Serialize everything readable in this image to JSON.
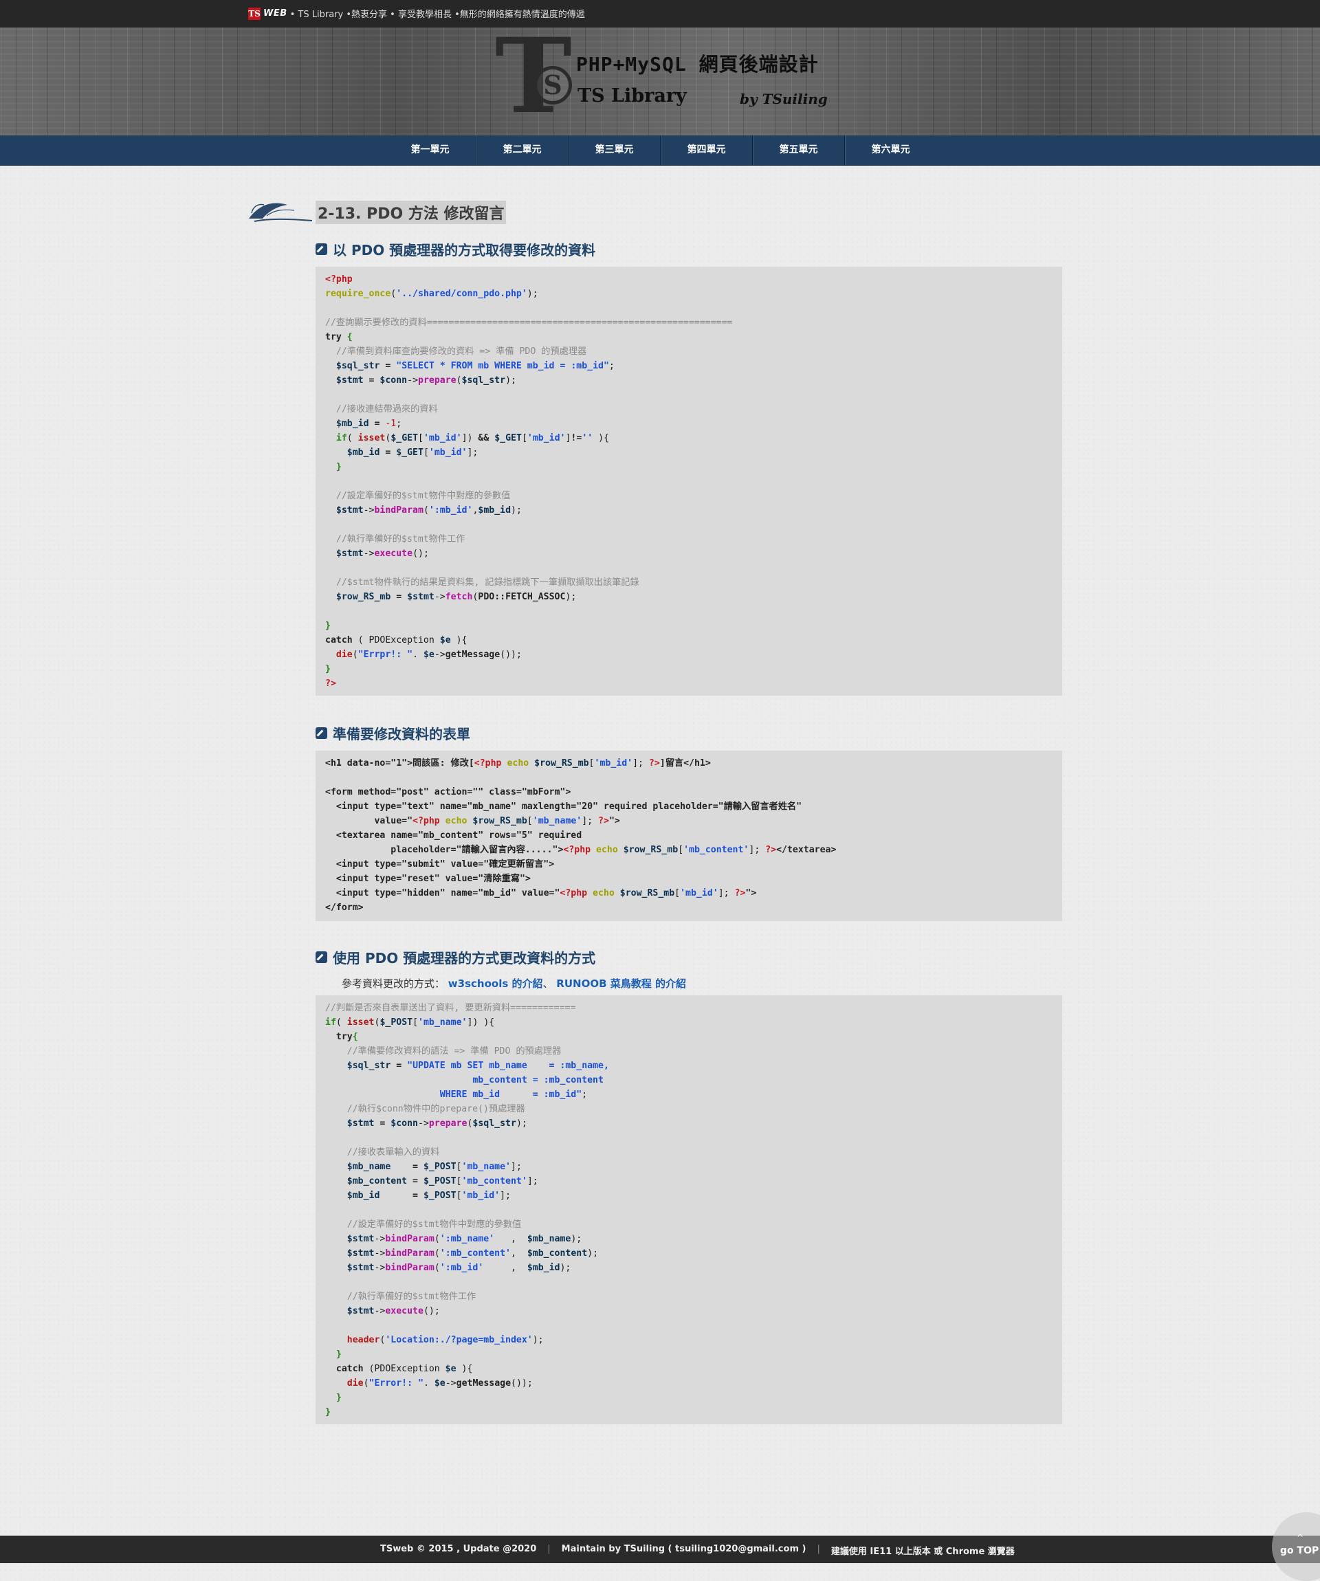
{
  "topbar": {
    "logo": "TS",
    "web": "WEB",
    "tagline": "• TS Library •熱衷分享 • 享受教學相長 •無形的網絡擁有熱情溫度的傳遞"
  },
  "header": {
    "title": "PHP+MySQL 網頁後端設計",
    "subtitle": "TS Library",
    "by": "by TSuiling",
    "mark_t": "T",
    "mark_s": "S"
  },
  "nav": {
    "items": [
      {
        "label": "第一單元"
      },
      {
        "label": "第二單元"
      },
      {
        "label": "第三單元"
      },
      {
        "label": "第四單元"
      },
      {
        "label": "第五單元"
      },
      {
        "label": "第六單元"
      }
    ]
  },
  "page": {
    "title": "2-13. PDO 方法 修改留言"
  },
  "sections": [
    {
      "heading": "以 PDO 預處理器的方式取得要修改的資料",
      "code": [
        [
          [
            "t-tag",
            "<?php"
          ]
        ],
        [
          [
            "t-fn",
            "require_once"
          ],
          [
            "",
            "("
          ],
          [
            "t-str",
            "'../shared/conn_pdo.php'"
          ],
          [
            "",
            ");"
          ]
        ],
        [],
        [
          [
            "t-cmt",
            "//查詢顯示要修改的資料========================================================"
          ]
        ],
        [
          [
            "t-kw",
            "try "
          ],
          [
            "t-brk",
            "{"
          ]
        ],
        [
          [
            "t-cmt",
            "  //準備到資料庫查詢要修改的資料 => 準備 PDO 的預處理器"
          ]
        ],
        [
          [
            "",
            "  "
          ],
          [
            "t-var",
            "$sql_str"
          ],
          [
            "t-kw",
            " = "
          ],
          [
            "t-str",
            "\"SELECT * FROM mb WHERE mb_id = :mb_id\""
          ],
          [
            "",
            ";"
          ]
        ],
        [
          [
            "",
            "  "
          ],
          [
            "t-var",
            "$stmt"
          ],
          [
            "t-kw",
            " = "
          ],
          [
            "t-var",
            "$conn"
          ],
          [
            "",
            "->"
          ],
          [
            "t-mtd",
            "prepare"
          ],
          [
            "",
            "("
          ],
          [
            "t-var",
            "$sql_str"
          ],
          [
            "",
            ");"
          ]
        ],
        [],
        [
          [
            "t-cmt",
            "  //接收連結帶過來的資料"
          ]
        ],
        [
          [
            "",
            "  "
          ],
          [
            "t-var",
            "$mb_id"
          ],
          [
            "t-kw",
            " = "
          ],
          [
            "t-num",
            "-1"
          ],
          [
            "",
            ";"
          ]
        ],
        [
          [
            "",
            "  "
          ],
          [
            "t-brk",
            "if"
          ],
          [
            "",
            "( "
          ],
          [
            "t-die",
            "isset"
          ],
          [
            "",
            "("
          ],
          [
            "t-var",
            "$_GET"
          ],
          [
            "",
            "["
          ],
          [
            "t-str",
            "'mb_id'"
          ],
          [
            "",
            "]) "
          ],
          [
            "t-kw",
            "&&"
          ],
          [
            "",
            " "
          ],
          [
            "t-var",
            "$_GET"
          ],
          [
            "",
            "["
          ],
          [
            "t-str",
            "'mb_id'"
          ],
          [
            "",
            "]"
          ],
          [
            "t-kw",
            "!="
          ],
          [
            "t-str",
            "''"
          ],
          [
            "",
            " ){"
          ]
        ],
        [
          [
            "",
            "    "
          ],
          [
            "t-var",
            "$mb_id"
          ],
          [
            "t-kw",
            " = "
          ],
          [
            "t-var",
            "$_GET"
          ],
          [
            "",
            "["
          ],
          [
            "t-str",
            "'mb_id'"
          ],
          [
            "",
            "];"
          ]
        ],
        [
          [
            "",
            "  "
          ],
          [
            "t-brk",
            "}"
          ]
        ],
        [],
        [
          [
            "t-cmt",
            "  //設定準備好的$stmt物件中對應的參數值"
          ]
        ],
        [
          [
            "",
            "  "
          ],
          [
            "t-var",
            "$stmt"
          ],
          [
            "",
            "->"
          ],
          [
            "t-mtd",
            "bindParam"
          ],
          [
            "",
            "("
          ],
          [
            "t-str",
            "':mb_id'"
          ],
          [
            "",
            ","
          ],
          [
            "t-var",
            "$mb_id"
          ],
          [
            "",
            ");"
          ]
        ],
        [],
        [
          [
            "t-cmt",
            "  //執行準備好的$stmt物件工作"
          ]
        ],
        [
          [
            "",
            "  "
          ],
          [
            "t-var",
            "$stmt"
          ],
          [
            "",
            "->"
          ],
          [
            "t-mtd",
            "execute"
          ],
          [
            "",
            "();"
          ]
        ],
        [],
        [
          [
            "t-cmt",
            "  //$stmt物件執行的結果是資料集, 記錄指標跳下一筆擷取擷取出該筆記錄"
          ]
        ],
        [
          [
            "",
            "  "
          ],
          [
            "t-var",
            "$row_RS_mb"
          ],
          [
            "t-kw",
            " = "
          ],
          [
            "t-var",
            "$stmt"
          ],
          [
            "",
            "->"
          ],
          [
            "t-mtd",
            "fetch"
          ],
          [
            "",
            "("
          ],
          [
            "t-kw",
            "PDO::FETCH_ASSOC"
          ],
          [
            "",
            ");"
          ]
        ],
        [],
        [
          [
            "t-brk",
            "}"
          ]
        ],
        [
          [
            "t-kw",
            "catch"
          ],
          [
            "",
            " ( PDOException "
          ],
          [
            "t-var",
            "$e"
          ],
          [
            "",
            " ){"
          ]
        ],
        [
          [
            "",
            "  "
          ],
          [
            "t-die",
            "die"
          ],
          [
            "",
            "("
          ],
          [
            "t-str",
            "\"Errpr!: \""
          ],
          [
            "",
            ". "
          ],
          [
            "t-var",
            "$e"
          ],
          [
            "",
            "->"
          ],
          [
            "t-kw",
            "getMessage"
          ],
          [
            "",
            "());"
          ]
        ],
        [
          [
            "t-brk",
            "}"
          ]
        ],
        [
          [
            "t-tag",
            "?>"
          ]
        ]
      ]
    },
    {
      "heading": "準備要修改資料的表單",
      "code": [
        [
          [
            "t-kw",
            "<h1 data-no=\"1\">問該區: 修改["
          ],
          [
            "t-tag",
            "<?php "
          ],
          [
            "t-fn",
            "echo "
          ],
          [
            "t-var",
            "$row_RS_mb"
          ],
          [
            "",
            "["
          ],
          [
            "t-str",
            "'mb_id'"
          ],
          [
            "",
            "]; "
          ],
          [
            "t-tag",
            "?>"
          ],
          [
            "t-kw",
            "]留言</h1>"
          ]
        ],
        [],
        [
          [
            "t-kw",
            "<form method=\"post\" action=\"\" class=\"mbForm\">"
          ]
        ],
        [
          [
            "t-kw",
            "  <input type=\"text\" name=\"mb_name\" maxlength=\"20\" required placeholder=\"請輸入留言者姓名\""
          ]
        ],
        [
          [
            "t-kw",
            "         value=\""
          ],
          [
            "t-tag",
            "<?php "
          ],
          [
            "t-fn",
            "echo "
          ],
          [
            "t-var",
            "$row_RS_mb"
          ],
          [
            "",
            "["
          ],
          [
            "t-str",
            "'mb_name'"
          ],
          [
            "",
            "]; "
          ],
          [
            "t-tag",
            "?>"
          ],
          [
            "t-kw",
            "\">"
          ]
        ],
        [
          [
            "t-kw",
            "  <textarea name=\"mb_content\" rows=\"5\" required"
          ]
        ],
        [
          [
            "t-kw",
            "            placeholder=\"請輸入留言內容.....\">"
          ],
          [
            "t-tag",
            "<?php "
          ],
          [
            "t-fn",
            "echo "
          ],
          [
            "t-var",
            "$row_RS_mb"
          ],
          [
            "",
            "["
          ],
          [
            "t-str",
            "'mb_content'"
          ],
          [
            "",
            "]; "
          ],
          [
            "t-tag",
            "?>"
          ],
          [
            "t-kw",
            "</textarea>"
          ]
        ],
        [
          [
            "t-kw",
            "  <input type=\"submit\" value=\"確定更新留言\">"
          ]
        ],
        [
          [
            "t-kw",
            "  <input type=\"reset\" value=\"清除重寫\">"
          ]
        ],
        [
          [
            "t-kw",
            "  <input type=\"hidden\" name=\"mb_id\" value=\""
          ],
          [
            "t-tag",
            "<?php "
          ],
          [
            "t-fn",
            "echo "
          ],
          [
            "t-var",
            "$row_RS_mb"
          ],
          [
            "",
            "["
          ],
          [
            "t-str",
            "'mb_id'"
          ],
          [
            "",
            "]; "
          ],
          [
            "t-tag",
            "?>"
          ],
          [
            "t-kw",
            "\">"
          ]
        ],
        [
          [
            "t-kw",
            "</form>"
          ]
        ]
      ]
    },
    {
      "heading": "使用 PDO 預處理器的方式更改資料的方式",
      "ref_label": "參考資料更改的方式：",
      "ref_link1": "w3schools 的介紹",
      "ref_sep": "、",
      "ref_link2": "RUNOOB 菜鳥教程 的介紹",
      "code": [
        [
          [
            "t-cmt",
            "//判斷是否來自表單送出了資料, 要更新資料============"
          ]
        ],
        [
          [
            "t-brk",
            "if"
          ],
          [
            "",
            "( "
          ],
          [
            "t-die",
            "isset"
          ],
          [
            "",
            "("
          ],
          [
            "t-var",
            "$_POST"
          ],
          [
            "",
            "["
          ],
          [
            "t-str",
            "'mb_name'"
          ],
          [
            "",
            "]) ){"
          ]
        ],
        [
          [
            "t-kw",
            "  try"
          ],
          [
            "t-brk",
            "{"
          ]
        ],
        [
          [
            "t-cmt",
            "    //準備要修改資料的語法 => 準備 PDO 的預處理器"
          ]
        ],
        [
          [
            "",
            "    "
          ],
          [
            "t-var",
            "$sql_str"
          ],
          [
            "t-kw",
            " = "
          ],
          [
            "t-str",
            "\"UPDATE mb SET mb_name    = :mb_name,"
          ]
        ],
        [
          [
            "t-str",
            "                           mb_content = :mb_content"
          ]
        ],
        [
          [
            "t-str",
            "                     WHERE mb_id      = :mb_id\""
          ],
          [
            "",
            ";"
          ]
        ],
        [
          [
            "t-cmt",
            "    //執行$conn物件中的prepare()預處理器"
          ]
        ],
        [
          [
            "",
            "    "
          ],
          [
            "t-var",
            "$stmt"
          ],
          [
            "t-kw",
            " = "
          ],
          [
            "t-var",
            "$conn"
          ],
          [
            "",
            "->"
          ],
          [
            "t-mtd",
            "prepare"
          ],
          [
            "",
            "("
          ],
          [
            "t-var",
            "$sql_str"
          ],
          [
            "",
            ");"
          ]
        ],
        [],
        [
          [
            "t-cmt",
            "    //接收表單輸入的資料"
          ]
        ],
        [
          [
            "",
            "    "
          ],
          [
            "t-var",
            "$mb_name   "
          ],
          [
            "t-kw",
            " = "
          ],
          [
            "t-var",
            "$_POST"
          ],
          [
            "",
            "["
          ],
          [
            "t-str",
            "'mb_name'"
          ],
          [
            "",
            "];"
          ]
        ],
        [
          [
            "",
            "    "
          ],
          [
            "t-var",
            "$mb_content"
          ],
          [
            "t-kw",
            " = "
          ],
          [
            "t-var",
            "$_POST"
          ],
          [
            "",
            "["
          ],
          [
            "t-str",
            "'mb_content'"
          ],
          [
            "",
            "];"
          ]
        ],
        [
          [
            "",
            "    "
          ],
          [
            "t-var",
            "$mb_id     "
          ],
          [
            "t-kw",
            " = "
          ],
          [
            "t-var",
            "$_POST"
          ],
          [
            "",
            "["
          ],
          [
            "t-str",
            "'mb_id'"
          ],
          [
            "",
            "];"
          ]
        ],
        [],
        [
          [
            "t-cmt",
            "    //設定準備好的$stmt物件中對應的參數值"
          ]
        ],
        [
          [
            "",
            "    "
          ],
          [
            "t-var",
            "$stmt"
          ],
          [
            "",
            "->"
          ],
          [
            "t-mtd",
            "bindParam"
          ],
          [
            "",
            "("
          ],
          [
            "t-str",
            "':mb_name'   "
          ],
          [
            "",
            ",  "
          ],
          [
            "t-var",
            "$mb_name"
          ],
          [
            "",
            ");"
          ]
        ],
        [
          [
            "",
            "    "
          ],
          [
            "t-var",
            "$stmt"
          ],
          [
            "",
            "->"
          ],
          [
            "t-mtd",
            "bindParam"
          ],
          [
            "",
            "("
          ],
          [
            "t-str",
            "':mb_content'"
          ],
          [
            "",
            ",  "
          ],
          [
            "t-var",
            "$mb_content"
          ],
          [
            "",
            ");"
          ]
        ],
        [
          [
            "",
            "    "
          ],
          [
            "t-var",
            "$stmt"
          ],
          [
            "",
            "->"
          ],
          [
            "t-mtd",
            "bindParam"
          ],
          [
            "",
            "("
          ],
          [
            "t-str",
            "':mb_id'     "
          ],
          [
            "",
            ",  "
          ],
          [
            "t-var",
            "$mb_id"
          ],
          [
            "",
            ");"
          ]
        ],
        [],
        [
          [
            "t-cmt",
            "    //執行準備好的$stmt物件工作"
          ]
        ],
        [
          [
            "",
            "    "
          ],
          [
            "t-var",
            "$stmt"
          ],
          [
            "",
            "->"
          ],
          [
            "t-mtd",
            "execute"
          ],
          [
            "",
            "();"
          ]
        ],
        [],
        [
          [
            "",
            "    "
          ],
          [
            "t-die",
            "header"
          ],
          [
            "",
            "("
          ],
          [
            "t-str",
            "'Location:./?page=mb_index'"
          ],
          [
            "",
            ");"
          ]
        ],
        [
          [
            "t-brk",
            "  }"
          ]
        ],
        [
          [
            "t-kw",
            "  catch"
          ],
          [
            "",
            " (PDOException "
          ],
          [
            "t-var",
            "$e"
          ],
          [
            "",
            " ){"
          ]
        ],
        [
          [
            "",
            "    "
          ],
          [
            "t-die",
            "die"
          ],
          [
            "",
            "("
          ],
          [
            "t-str",
            "\"Error!: \""
          ],
          [
            "",
            ". "
          ],
          [
            "t-var",
            "$e"
          ],
          [
            "",
            "->"
          ],
          [
            "t-kw",
            "getMessage"
          ],
          [
            "",
            "());"
          ]
        ],
        [
          [
            "t-brk",
            "  }"
          ]
        ],
        [
          [
            "t-brk",
            "}"
          ]
        ]
      ]
    }
  ],
  "footer": {
    "copyright": "TSweb © 2015 , Update @2020",
    "maintain": "Maintain by TSuiling ( tsuiling1020@gmail.com )",
    "browser": "建議使用 IE11 以上版本 或 Chrome 瀏覽器",
    "sep": "|"
  },
  "gotop": {
    "label": "go TOP",
    "arrow": "^"
  }
}
